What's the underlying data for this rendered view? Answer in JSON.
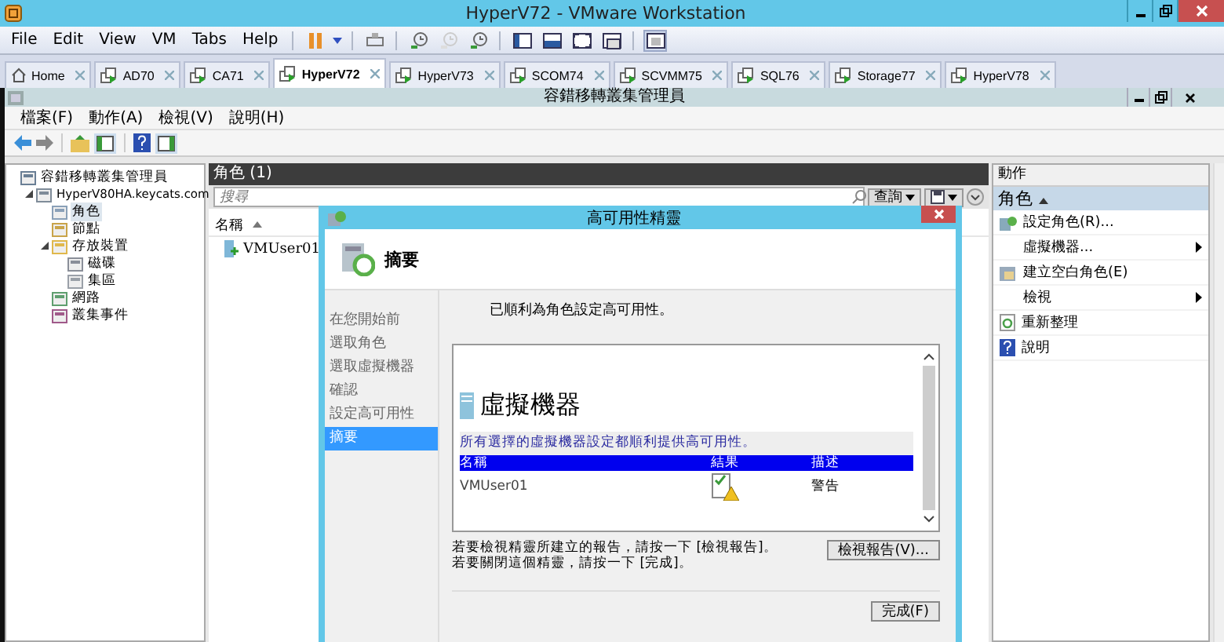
{
  "window": {
    "title": "HyperV72 - VMware Workstation"
  },
  "menu": [
    "File",
    "Edit",
    "View",
    "VM",
    "Tabs",
    "Help"
  ],
  "tabs": [
    {
      "label": "Home",
      "kind": "home",
      "selected": false
    },
    {
      "label": "AD70",
      "kind": "vm",
      "selected": false
    },
    {
      "label": "CA71",
      "kind": "vm",
      "selected": false
    },
    {
      "label": "HyperV72",
      "kind": "vm",
      "selected": true
    },
    {
      "label": "HyperV73",
      "kind": "vm",
      "selected": false
    },
    {
      "label": "SCOM74",
      "kind": "vm",
      "selected": false
    },
    {
      "label": "SCVMM75",
      "kind": "vm",
      "selected": false
    },
    {
      "label": "SQL76",
      "kind": "vm",
      "selected": false
    },
    {
      "label": "Storage77",
      "kind": "vm",
      "selected": false
    },
    {
      "label": "HyperV78",
      "kind": "vm",
      "selected": false
    }
  ],
  "console": {
    "title": "容錯移轉叢集管理員",
    "menu": [
      "檔案(F)",
      "動作(A)",
      "檢視(V)",
      "說明(H)"
    ]
  },
  "tree": [
    {
      "label": "容錯移轉叢集管理員",
      "kind": "manager",
      "children": [
        {
          "label": "HyperV80HA.keycats.com",
          "kind": "cluster",
          "expanded": true,
          "children": [
            {
              "label": "角色",
              "kind": "roles",
              "selected": true
            },
            {
              "label": "節點",
              "kind": "nodes",
              "selected": false
            },
            {
              "label": "存放裝置",
              "kind": "folder",
              "expanded": true,
              "selected": false,
              "children": [
                {
                  "label": "磁碟",
                  "kind": "disk",
                  "selected": false
                },
                {
                  "label": "集區",
                  "kind": "pool",
                  "selected": false
                }
              ]
            },
            {
              "label": "網路",
              "kind": "network",
              "selected": false
            },
            {
              "label": "叢集事件",
              "kind": "events",
              "selected": false
            }
          ]
        }
      ]
    }
  ],
  "center": {
    "header": "角色 (1)",
    "search": {
      "placeholder": "搜尋"
    },
    "query_button": "查詢",
    "columns": [
      "名稱"
    ],
    "rows": [
      {
        "name": "VMUser01"
      }
    ]
  },
  "wizard": {
    "title": "高可用性精靈",
    "heading": "摘要",
    "steps": [
      {
        "label": "在您開始前",
        "selected": false
      },
      {
        "label": "選取角色",
        "selected": false
      },
      {
        "label": "選取虛擬機器",
        "selected": false
      },
      {
        "label": "確認",
        "selected": false
      },
      {
        "label": "設定高可用性",
        "selected": false
      },
      {
        "label": "摘要",
        "selected": true
      }
    ],
    "message": "已順利為角色設定高可用性。",
    "report": {
      "heading": "虛擬機器",
      "note": "所有選擇的虛擬機器設定都順利提供高可用性。",
      "columns": [
        "名稱",
        "結果",
        "描述"
      ],
      "rows": [
        {
          "name": "VMUser01",
          "kind": "warning",
          "description": "警告"
        }
      ]
    },
    "instructions": [
      "若要檢視精靈所建立的報告，請按一下 [檢視報告]。",
      "若要關閉這個精靈，請按一下 [完成]。"
    ],
    "view_report_button": "檢視報告(V)...",
    "finish_button": "完成(F)"
  },
  "actions": {
    "title": "動作",
    "section": "角色",
    "items": [
      {
        "label": "設定角色(R)...",
        "kind": "configure",
        "submenu": false
      },
      {
        "label": "虛擬機器...",
        "kind": "none",
        "submenu": true
      },
      {
        "label": "建立空白角色(E)",
        "kind": "create",
        "submenu": false
      },
      {
        "label": "檢視",
        "kind": "none",
        "submenu": true
      },
      {
        "label": "重新整理",
        "kind": "refresh",
        "submenu": false
      },
      {
        "label": "說明",
        "kind": "help",
        "submenu": false
      }
    ]
  }
}
